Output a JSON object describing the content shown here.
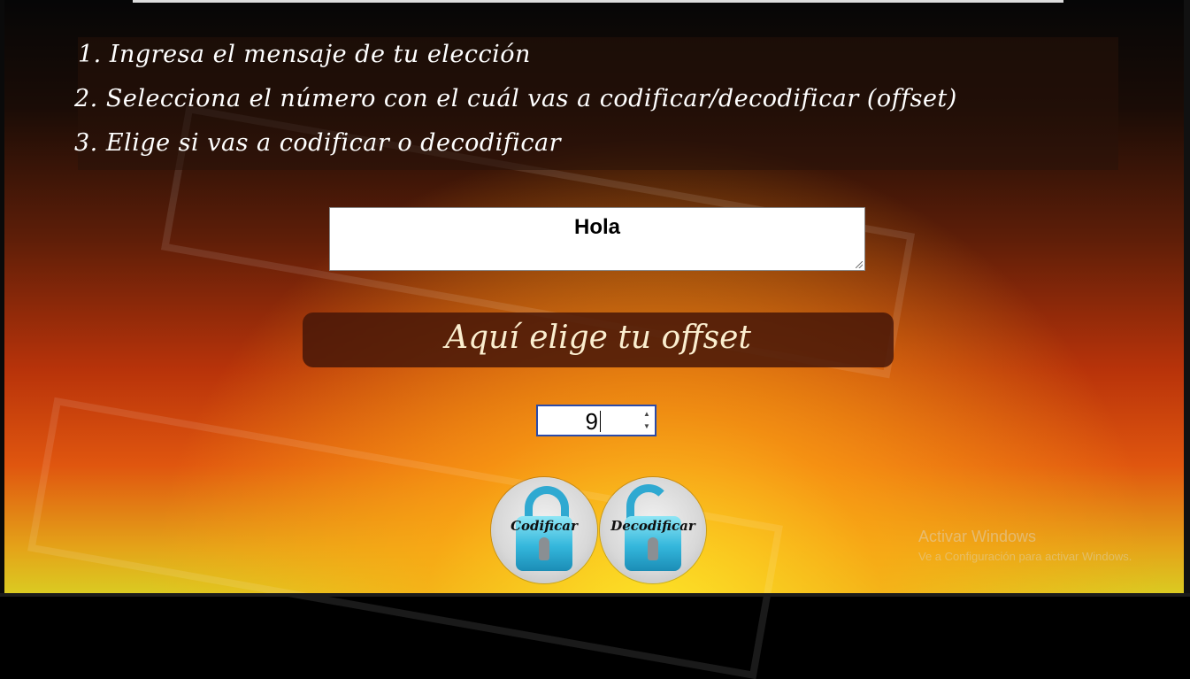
{
  "instructions": {
    "step1": "1. Ingresa el mensaje de tu elección",
    "step2": "2. Selecciona el número con el cuál vas a codificar/decodificar (offset)",
    "step3": "3. Elige si vas a codificar o decodificar"
  },
  "message_input": {
    "value": "Hola"
  },
  "offset_banner": {
    "label": "Aquí elige tu offset"
  },
  "offset_input": {
    "value": "9"
  },
  "buttons": {
    "encode_label": "Codificar",
    "decode_label": "Decodificar"
  },
  "watermark": {
    "title": "Activar Windows",
    "subtitle": "Ve a Configuración para activar Windows."
  },
  "colors": {
    "lock_blue": "#34b7dc",
    "banner_bg": "#46160a",
    "offset_border": "#2a4aa8"
  }
}
